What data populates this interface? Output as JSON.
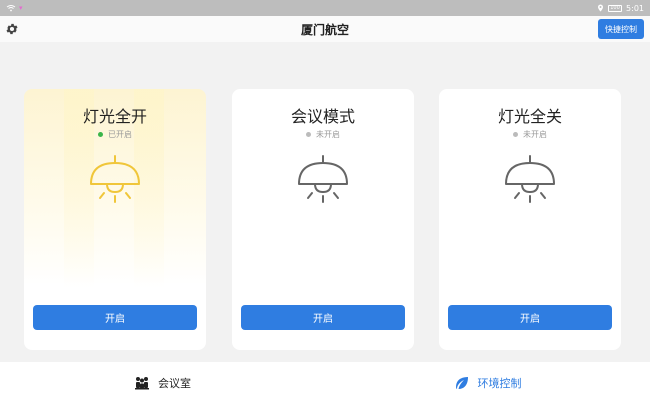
{
  "status_bar": {
    "battery": "100",
    "time": "5:01"
  },
  "header": {
    "title": "厦门航空",
    "quick_control_label": "快捷控制"
  },
  "cards": [
    {
      "title": "灯光全开",
      "status": "已开启",
      "on": true,
      "button_label": "开启",
      "lamp_color": "#f0c63a"
    },
    {
      "title": "会议模式",
      "status": "未开启",
      "on": false,
      "button_label": "开启",
      "lamp_color": "#666666"
    },
    {
      "title": "灯光全关",
      "status": "未开启",
      "on": false,
      "button_label": "开启",
      "lamp_color": "#666666"
    }
  ],
  "bottom_nav": {
    "items": [
      {
        "label": "会议室",
        "icon": "people-icon",
        "active": false
      },
      {
        "label": "环境控制",
        "icon": "leaf-icon",
        "active": true
      }
    ]
  },
  "colors": {
    "accent": "#2f7de1",
    "status_on": "#3bb54a",
    "status_off": "#bbbbbb"
  }
}
